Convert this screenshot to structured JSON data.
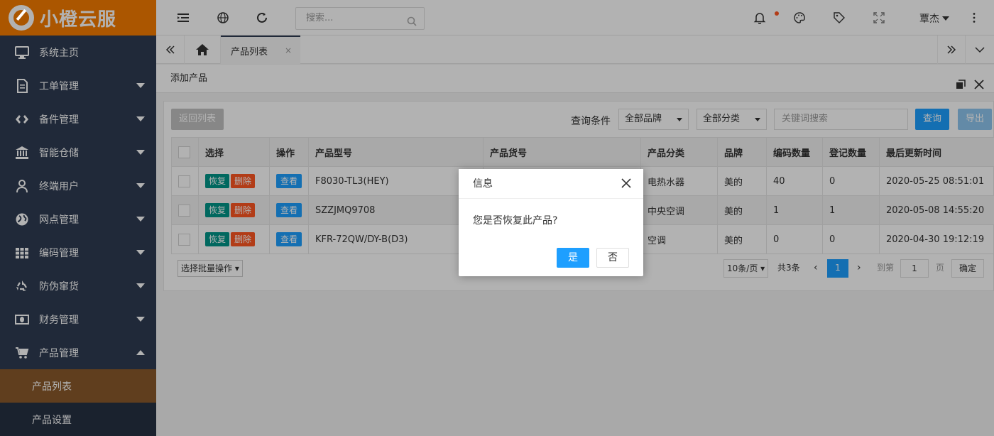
{
  "app": {
    "logo_text": "小橙云服"
  },
  "sidebar": {
    "items": [
      {
        "label": "系统主页",
        "icon": "monitor-icon"
      },
      {
        "label": "工单管理",
        "icon": "document-icon"
      },
      {
        "label": "备件管理",
        "icon": "diamond-icon"
      },
      {
        "label": "智能仓储",
        "icon": "bank-icon"
      },
      {
        "label": "终端用户",
        "icon": "user-icon"
      },
      {
        "label": "网点管理",
        "icon": "globe-icon"
      },
      {
        "label": "编码管理",
        "icon": "grid-icon"
      },
      {
        "label": "防伪窜货",
        "icon": "recycle-icon"
      },
      {
        "label": "财务管理",
        "icon": "money-icon"
      },
      {
        "label": "产品管理",
        "icon": "cart-icon"
      }
    ],
    "sub_items": [
      {
        "label": "产品列表"
      },
      {
        "label": "产品设置"
      }
    ]
  },
  "topbar": {
    "search_placeholder": "搜索...",
    "user_name": "覃杰"
  },
  "tabs": {
    "active_label": "产品列表",
    "close_glyph": "×"
  },
  "content": {
    "title": "添加产品"
  },
  "toolbar": {
    "back_label": "返回列表",
    "query_condition_label": "查询条件",
    "brand_select": "全部品牌",
    "category_select": "全部分类",
    "keyword_placeholder": "关键词搜索",
    "query_label": "查询",
    "export_label": "导出"
  },
  "table": {
    "headers": [
      "选择",
      "操作",
      "产品型号",
      "产品货号",
      "产品分类",
      "品牌",
      "编码数量",
      "登记数量",
      "最后更新时间"
    ],
    "action_labels": {
      "restore": "恢复",
      "delete": "删除",
      "view": "查看"
    },
    "rows": [
      {
        "model": "F8030-TL3(HEY)",
        "sku": "",
        "category": "电热水器",
        "brand": "美的",
        "code_count": "40",
        "reg_count": "0",
        "updated": "2020-05-25 08:51:01"
      },
      {
        "model": "SZZJMQ9708",
        "sku": "",
        "category": "中央空调",
        "brand": "美的",
        "code_count": "1",
        "reg_count": "1",
        "updated": "2020-05-08 14:55:20"
      },
      {
        "model": "KFR-72QW/DY-B(D3)",
        "sku": "",
        "category": "空调",
        "brand": "美的",
        "code_count": "0",
        "reg_count": "0",
        "updated": "2020-04-30 19:12:19"
      }
    ]
  },
  "footer": {
    "batch_label": "选择批量操作",
    "page_size": "10条/页",
    "total": "共3条",
    "current_page": "1",
    "goto_label": "到第",
    "goto_value": "1",
    "page_unit": "页",
    "confirm_label": "确定"
  },
  "dialog": {
    "title": "信息",
    "message": "您是否恢复此产品?",
    "yes_label": "是",
    "no_label": "否"
  },
  "colors": {
    "brand_orange": "#f57c00",
    "sidebar_bg": "#2f3c52",
    "primary_blue": "#1e9fff",
    "green": "#009688",
    "red": "#ff5722"
  }
}
